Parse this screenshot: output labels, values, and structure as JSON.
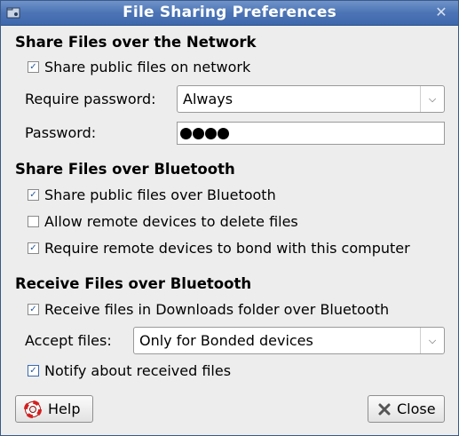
{
  "window": {
    "title": "File Sharing Preferences",
    "close_glyph": "✕"
  },
  "network": {
    "heading": "Share Files over the Network",
    "share_public": {
      "label": "Share public files on network",
      "checked": true
    },
    "require_password": {
      "label": "Require password:",
      "value": "Always"
    },
    "password": {
      "label": "Password:",
      "masked_length": 4
    }
  },
  "bluetooth": {
    "heading": "Share Files over Bluetooth",
    "share_public": {
      "label": "Share public files over Bluetooth",
      "checked": true
    },
    "allow_delete": {
      "label": "Allow remote devices to delete files",
      "checked": false
    },
    "require_bond": {
      "label": "Require remote devices to bond with this computer",
      "checked": true
    }
  },
  "receive": {
    "heading": "Receive Files over Bluetooth",
    "downloads": {
      "label": "Receive files in Downloads folder over Bluetooth",
      "checked": true
    },
    "accept_files": {
      "label": "Accept files:",
      "value": "Only for Bonded devices"
    },
    "notify": {
      "label": "Notify about received files",
      "checked": true
    }
  },
  "buttons": {
    "help": "Help",
    "close": "Close"
  },
  "icons": {
    "app": "folder-share-icon",
    "help": "lifebuoy-icon",
    "close": "close-x-icon",
    "combo_arrow": "chevron-down-icon"
  }
}
